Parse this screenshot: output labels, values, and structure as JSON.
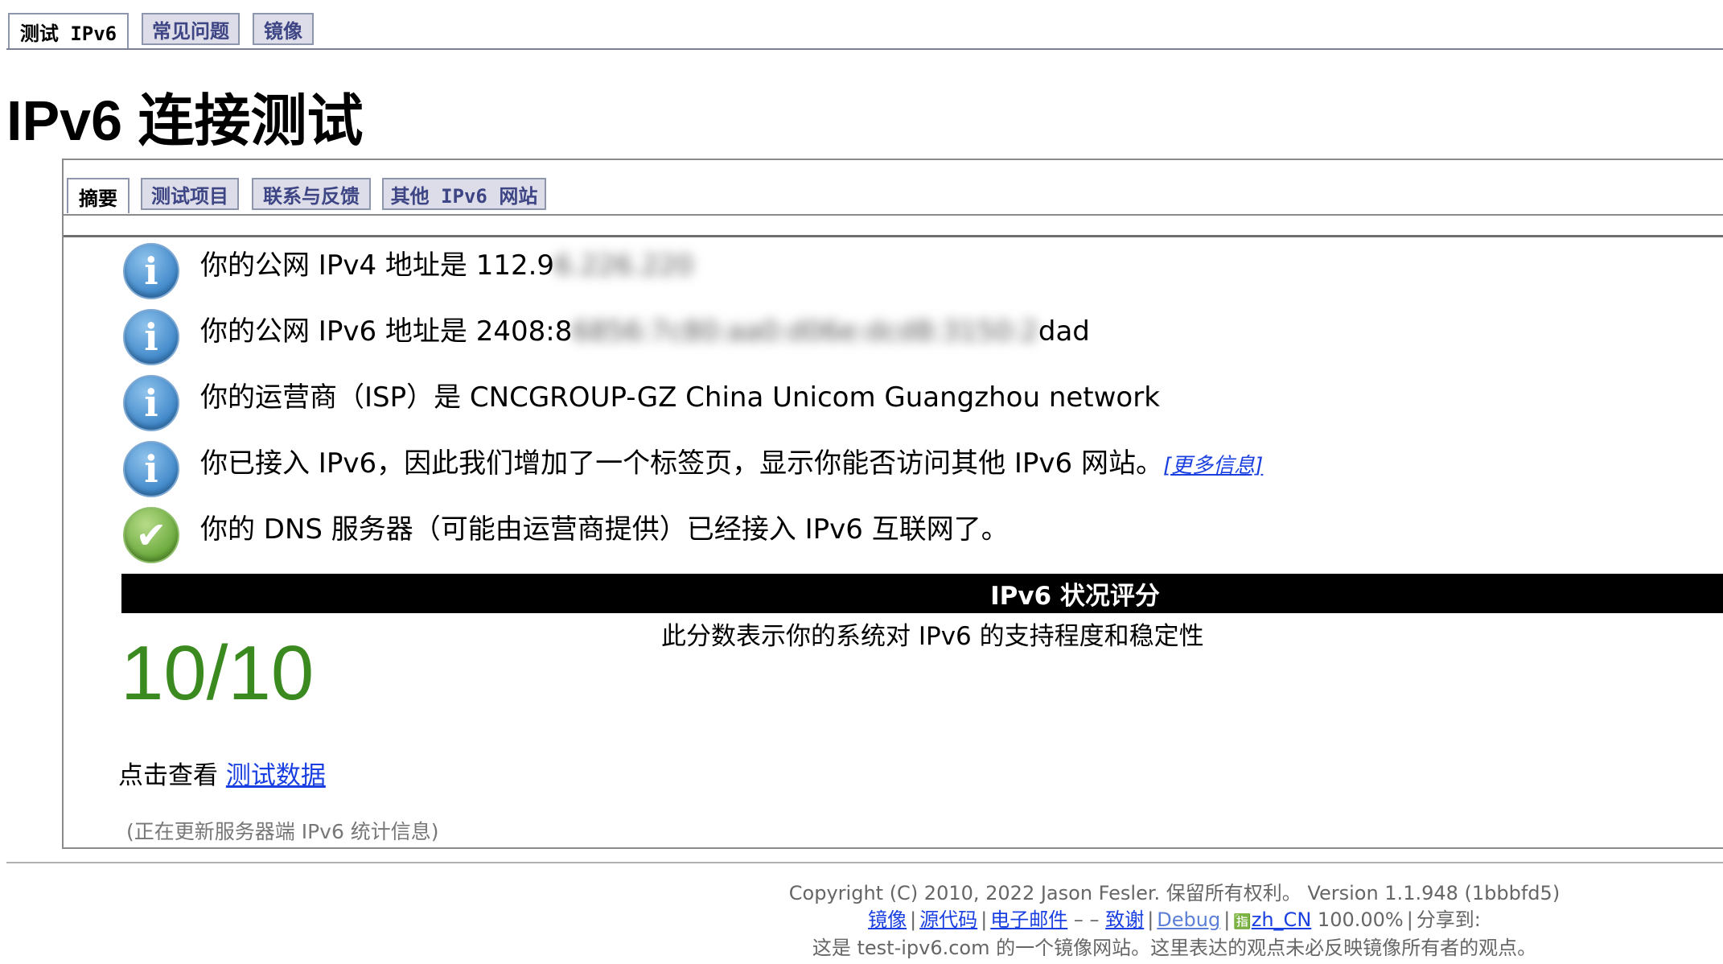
{
  "top_tabs": [
    {
      "label": "测试 IPv6",
      "active": true
    },
    {
      "label": "常见问题",
      "active": false
    },
    {
      "label": "镜像",
      "active": false
    }
  ],
  "page_title": "IPv6 连接测试",
  "inner_tabs": [
    {
      "label": "摘要",
      "active": true
    },
    {
      "label": "测试项目",
      "active": false
    },
    {
      "label": "联系与反馈",
      "active": false
    },
    {
      "label": "其他 IPv6 网站",
      "active": false
    }
  ],
  "messages": [
    {
      "icon": "info-icon",
      "prefix": "你的公网 IPv4 地址是 112.9",
      "hidden": "6.226.220",
      "suffix": ""
    },
    {
      "icon": "info-icon",
      "prefix": "你的公网 IPv6 地址是 2408:8",
      "hidden": "6856:7c80:aa0:d06e:dcd8:3150:2",
      "suffix": "dad"
    },
    {
      "icon": "info-icon",
      "text": "你的运营商（ISP）是 CNCGROUP-GZ China Unicom Guangzhou network"
    },
    {
      "icon": "info-icon",
      "text": "你已接入 IPv6，因此我们增加了一个标签页，显示你能否访问其他 IPv6 网站。",
      "link": "[更多信息]"
    },
    {
      "icon": "check-icon",
      "text": "你的 DNS 服务器（可能由运营商提供）已经接入 IPv6 互联网了。"
    }
  ],
  "score": {
    "header": "IPv6 状况评分",
    "description": "此分数表示你的系统对 IPv6 的支持程度和稳定性",
    "value": "10/10",
    "value_color": "#3a8a1f"
  },
  "view_data": {
    "prefix": "点击查看 ",
    "link": "测试数据"
  },
  "stats_note": "(正在更新服务器端 IPv6 统计信息)",
  "footer": {
    "line1": "Copyright (C) 2010, 2022 Jason Fesler. 保留所有权利。 Version 1.1.948 (1bbbfd5)",
    "links": {
      "mirror": "镜像",
      "source": "源代码",
      "email": "电子邮件",
      "thanks": "致谢",
      "debug": "Debug",
      "locale": "zh_CN"
    },
    "dashes": "–     –",
    "percent": "100.00%",
    "share": "分享到:",
    "line3": "这是 test-ipv6.com 的一个镜像网站。这里表达的观点未必反映镜像所有者的观点。"
  }
}
